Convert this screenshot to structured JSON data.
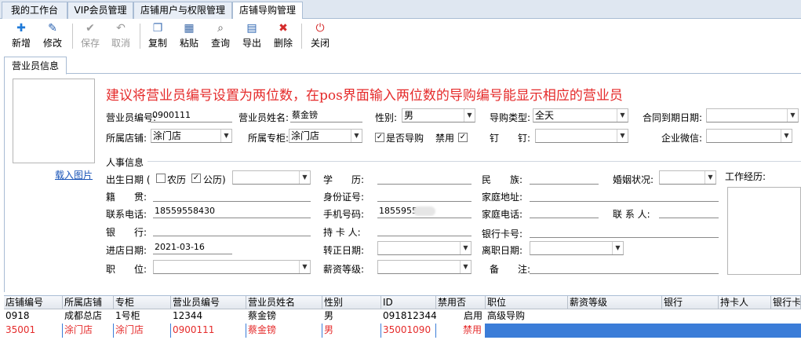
{
  "tabs": [
    "我的工作台",
    "VIP会员管理",
    "店铺用户与权限管理",
    "店铺导购管理"
  ],
  "toolbar": {
    "new": "新增",
    "edit": "修改",
    "save": "保存",
    "cancel": "取消",
    "copy": "复制",
    "paste": "粘贴",
    "query": "查询",
    "export": "导出",
    "delete": "删除",
    "close": "关闭"
  },
  "inner_tab": "营业员信息",
  "load_image": "载入图片",
  "banner": "建议将营业员编号设置为两位数，在pos界面输入两位数的导购编号能显示相应的营业员",
  "form": {
    "staff_no_label": "营业员编号:",
    "staff_no": "0900111",
    "staff_name_label": "营业员姓名:",
    "staff_name": "蔡金镑",
    "gender_label": "性别:",
    "gender": "男",
    "guide_type_label": "导购类型:",
    "guide_type": "全天",
    "contract_label": "合同到期日期:",
    "contract": "",
    "store_label": "所属店铺:",
    "store": "涂门店",
    "counter_label": "所属专柜:",
    "counter": "涂门店",
    "is_guide_label": "是否导购",
    "disabled_label": "禁用",
    "dingtalk_label": "钉　　钉:",
    "dingtalk": "",
    "wechat_label": "企业微信:",
    "wechat": ""
  },
  "hr": {
    "section_label": "人事信息",
    "birth_label": "出生日期 (",
    "lunar": "农历",
    "solar": "公历)",
    "education_label": "学　　历:",
    "ethnic_label": "民　　族:",
    "marital_label": "婚姻状况:",
    "work_exp_label": "工作经历:",
    "native_label": "籍　　贯:",
    "id_label": "身份证号:",
    "address_label": "家庭地址:",
    "phone_label": "联系电话:",
    "phone": "18559558430",
    "mobile_label": "手机号码:",
    "mobile": "1855955",
    "home_phone_label": "家庭电话:",
    "contact_label": "联 系 人:",
    "bank_label": "银　　行:",
    "holder_label": "持 卡 人:",
    "card_label": "银行卡号:",
    "join_label": "进店日期:",
    "join": "2021-03-16",
    "regular_label": "转正日期:",
    "leave_label": "离职日期:",
    "position_label": "职　　位:",
    "salary_label": "薪资等级:",
    "remark_label": "备　　注:"
  },
  "grid": {
    "headers": [
      "店铺编号",
      "所属店铺",
      "专柜",
      "营业员编号",
      "营业员姓名",
      "性别",
      "ID",
      "禁用否",
      "职位",
      "薪资等级",
      "银行",
      "持卡人",
      "银行卡"
    ],
    "rows": [
      [
        "0918",
        "成都总店",
        "1号柜",
        "12344",
        "蔡金镑",
        "男",
        "091812344",
        "启用",
        "高级导购",
        "",
        "",
        "",
        ""
      ],
      [
        "35001",
        "涂门店",
        "涂门店",
        "0900111",
        "蔡金镑",
        "男",
        "35001090",
        "禁用",
        "",
        "",
        "",
        "",
        ""
      ]
    ]
  },
  "colors": {
    "accent": "#3b7dd8",
    "banner": "#e52b2b",
    "selected_text": "#e52b2b"
  }
}
